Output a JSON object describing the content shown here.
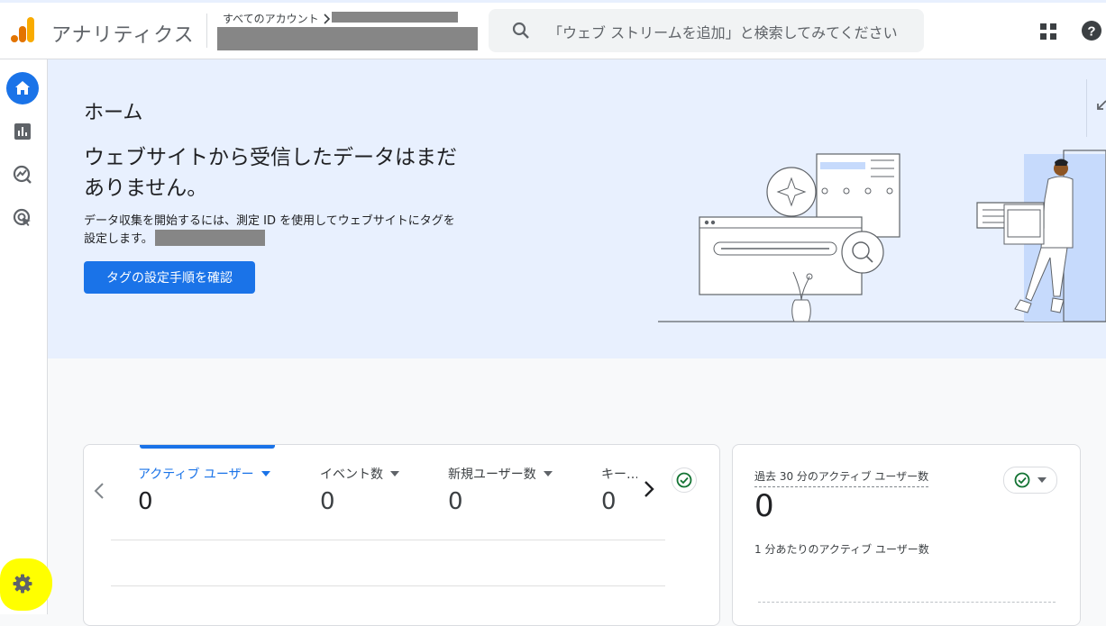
{
  "header": {
    "app_title": "アナリティクス",
    "breadcrumb_all_accounts": "すべてのアカウント",
    "search_placeholder": "「ウェブ ストリームを追加」と検索してみてください"
  },
  "banner": {
    "page_title": "ホーム",
    "headline": "ウェブサイトから受信したデータはまだありません。",
    "description": "データ収集を開始するには、測定 ID を使用してウェブサイトにタグを設定します。",
    "cta_label": "タグの設定手順を確認"
  },
  "metrics_card": {
    "metrics": [
      {
        "label": "アクティブ ユーザー",
        "value": "0",
        "selected": true
      },
      {
        "label": "イベント数",
        "value": "0"
      },
      {
        "label": "新規ユーザー数",
        "value": "0"
      },
      {
        "label": "キー…",
        "value": "0"
      }
    ]
  },
  "realtime_card": {
    "title": "過去 30 分のアクティブ ユーザー数",
    "value": "0",
    "subtitle": "1 分あたりのアクティブ ユーザー数"
  },
  "colors": {
    "accent": "#1a73e8",
    "banner_bg": "#e8f0fe",
    "highlight": "#ffff00",
    "logo_orange": "#f9ab00",
    "logo_dark": "#e37400"
  },
  "icons": [
    "analytics-logo",
    "search-icon",
    "apps-grid-icon",
    "help-icon",
    "home-icon",
    "reports-icon",
    "explore-icon",
    "advertising-icon",
    "gear-icon",
    "check-circle-icon",
    "chevron-left-icon",
    "chevron-right-icon",
    "caret-down-icon"
  ]
}
